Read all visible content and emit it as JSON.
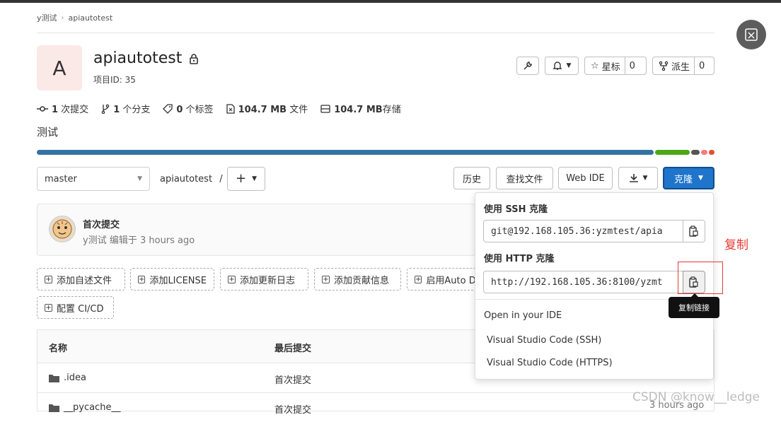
{
  "breadcrumb": {
    "group": "y测试",
    "project": "apiautotest"
  },
  "project": {
    "avatar_letter": "A",
    "name": "apiautotest",
    "id_text": "项目ID: 35"
  },
  "actions": {
    "star_label": "星标",
    "star_count": "0",
    "fork_label": "派生",
    "fork_count": "0"
  },
  "stats": [
    {
      "icon": "commit-icon",
      "count": "1",
      "label": " 次提交"
    },
    {
      "icon": "branch-icon",
      "count": "1",
      "label": " 个分支"
    },
    {
      "icon": "tag-icon",
      "count": "0",
      "label": " 个标签"
    },
    {
      "icon": "file-icon",
      "count": "104.7 MB",
      "label": " 文件"
    },
    {
      "icon": "storage-icon",
      "count": "104.7 MB",
      "label": "存储"
    }
  ],
  "description": "测试",
  "language_bar": [
    {
      "fraction": 0.915,
      "color": "#3572a5"
    },
    {
      "fraction": 0.052,
      "color": "#4fa617"
    },
    {
      "fraction": 0.012,
      "color": "#555555"
    },
    {
      "fraction": 0.01,
      "color": "#ff7a7a"
    },
    {
      "fraction": 0.008,
      "color": "#e84e2e"
    }
  ],
  "toolbar": {
    "branch": "master",
    "path": "apiautotest",
    "path_sep": "/",
    "history": "历史",
    "find_file": "查找文件",
    "web_ide": "Web IDE",
    "clone": "克隆"
  },
  "commit": {
    "title": "首次提交",
    "author": "y测试",
    "meta": " 编辑于 3 hours ago"
  },
  "quick_actions": [
    "添加自述文件",
    "添加LICENSE",
    "添加更新日志",
    "添加贡献信息",
    "启用Auto D",
    "配置 CI/CD"
  ],
  "table": {
    "headers": [
      "名称",
      "最后提交"
    ],
    "rows": [
      {
        "name": ".idea",
        "commit": "首次提交"
      },
      {
        "name": "__pycache__",
        "commit": "首次提交",
        "time": "3 hours ago"
      }
    ]
  },
  "clone_dropdown": {
    "ssh_label": "使用 SSH 克隆",
    "ssh_url": "git@192.168.105.36:yzmtest/apia",
    "http_label": "使用 HTTP 克隆",
    "http_url": "http://192.168.105.36:8100/yzmt",
    "ide_heading": "Open in your IDE",
    "ide_items": [
      "Visual Studio Code (SSH)",
      "Visual Studio Code (HTTPS)"
    ]
  },
  "tooltip": "复制链接",
  "annotation": "复制",
  "watermark": "CSDN @know__ledge"
}
